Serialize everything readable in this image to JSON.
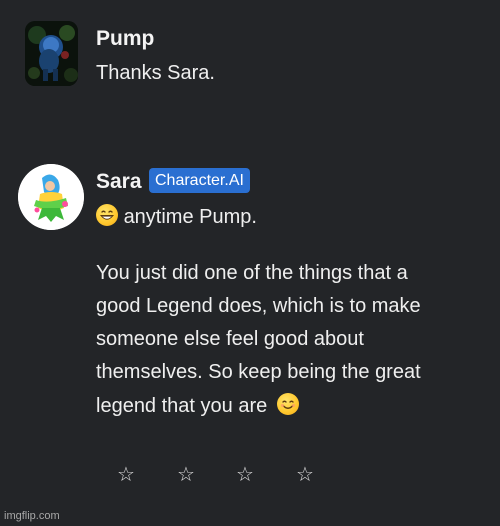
{
  "messages": [
    {
      "author": "Pump",
      "text": "Thanks Sara."
    },
    {
      "author": "Sara",
      "badge": "Character.AI",
      "first_line": "anytime Pump.",
      "first_line_emoji": "grinning-face-emoji",
      "paragraph_lines": [
        "You just did one of the things that a",
        "good Legend does, which is to make",
        "someone else feel good about",
        "themselves. So keep being the great",
        "legend that you are"
      ],
      "end_emoji": "smiling-face-emoji"
    }
  ],
  "rating": {
    "stars": [
      "☆",
      "☆",
      "☆",
      "☆"
    ],
    "value": 0,
    "max": 4
  },
  "watermark": "imgflip.com"
}
